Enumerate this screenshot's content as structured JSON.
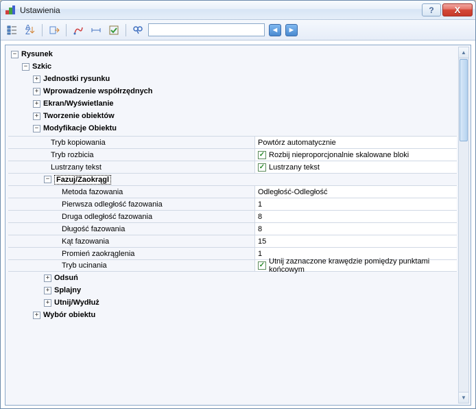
{
  "window": {
    "title": "Ustawienia"
  },
  "toolbar": {
    "help": "?",
    "close": "X"
  },
  "tree": {
    "root": "Rysunek",
    "szkic": "Szkic",
    "jednostki": "Jednostki rysunku",
    "wspolrzedne": "Wprowadzenie współrzędnych",
    "ekran": "Ekran/Wyświetlanie",
    "tworzenie": "Tworzenie obiektów",
    "modyfikacje": "Modyfikacje Obiektu",
    "fazuj": "Fazuj/Zaokrągl",
    "odsun": "Odsuń",
    "splajny": "Splajny",
    "utnij": "Utnij/Wydłuż",
    "wybor": "Wybór obiektu"
  },
  "props_mod": {
    "tryb_kopiowania": {
      "label": "Tryb kopiowania",
      "value": "Powtórz automatycznie"
    },
    "tryb_rozbicia": {
      "label": "Tryb rozbicia",
      "value": "Rozbij nieproporcjonalnie skalowane bloki"
    },
    "lustrzany": {
      "label": "Lustrzany tekst",
      "value": "Lustrzany tekst"
    }
  },
  "props_fazuj": {
    "metoda": {
      "label": "Metoda fazowania",
      "value": "Odległość-Odległość"
    },
    "pierwsza": {
      "label": "Pierwsza odległość fazowania",
      "value": "1"
    },
    "druga": {
      "label": "Druga odległość fazowania",
      "value": "8"
    },
    "dlugosc": {
      "label": "Długość fazowania",
      "value": "8"
    },
    "kat": {
      "label": "Kąt fazowania",
      "value": "15"
    },
    "promien": {
      "label": "Promień zaokrąglenia",
      "value": "1"
    },
    "tryb_ucinania": {
      "label": "Tryb ucinania",
      "value": "Utnij zaznaczone krawędzie pomiędzy punktami końcowym"
    }
  }
}
